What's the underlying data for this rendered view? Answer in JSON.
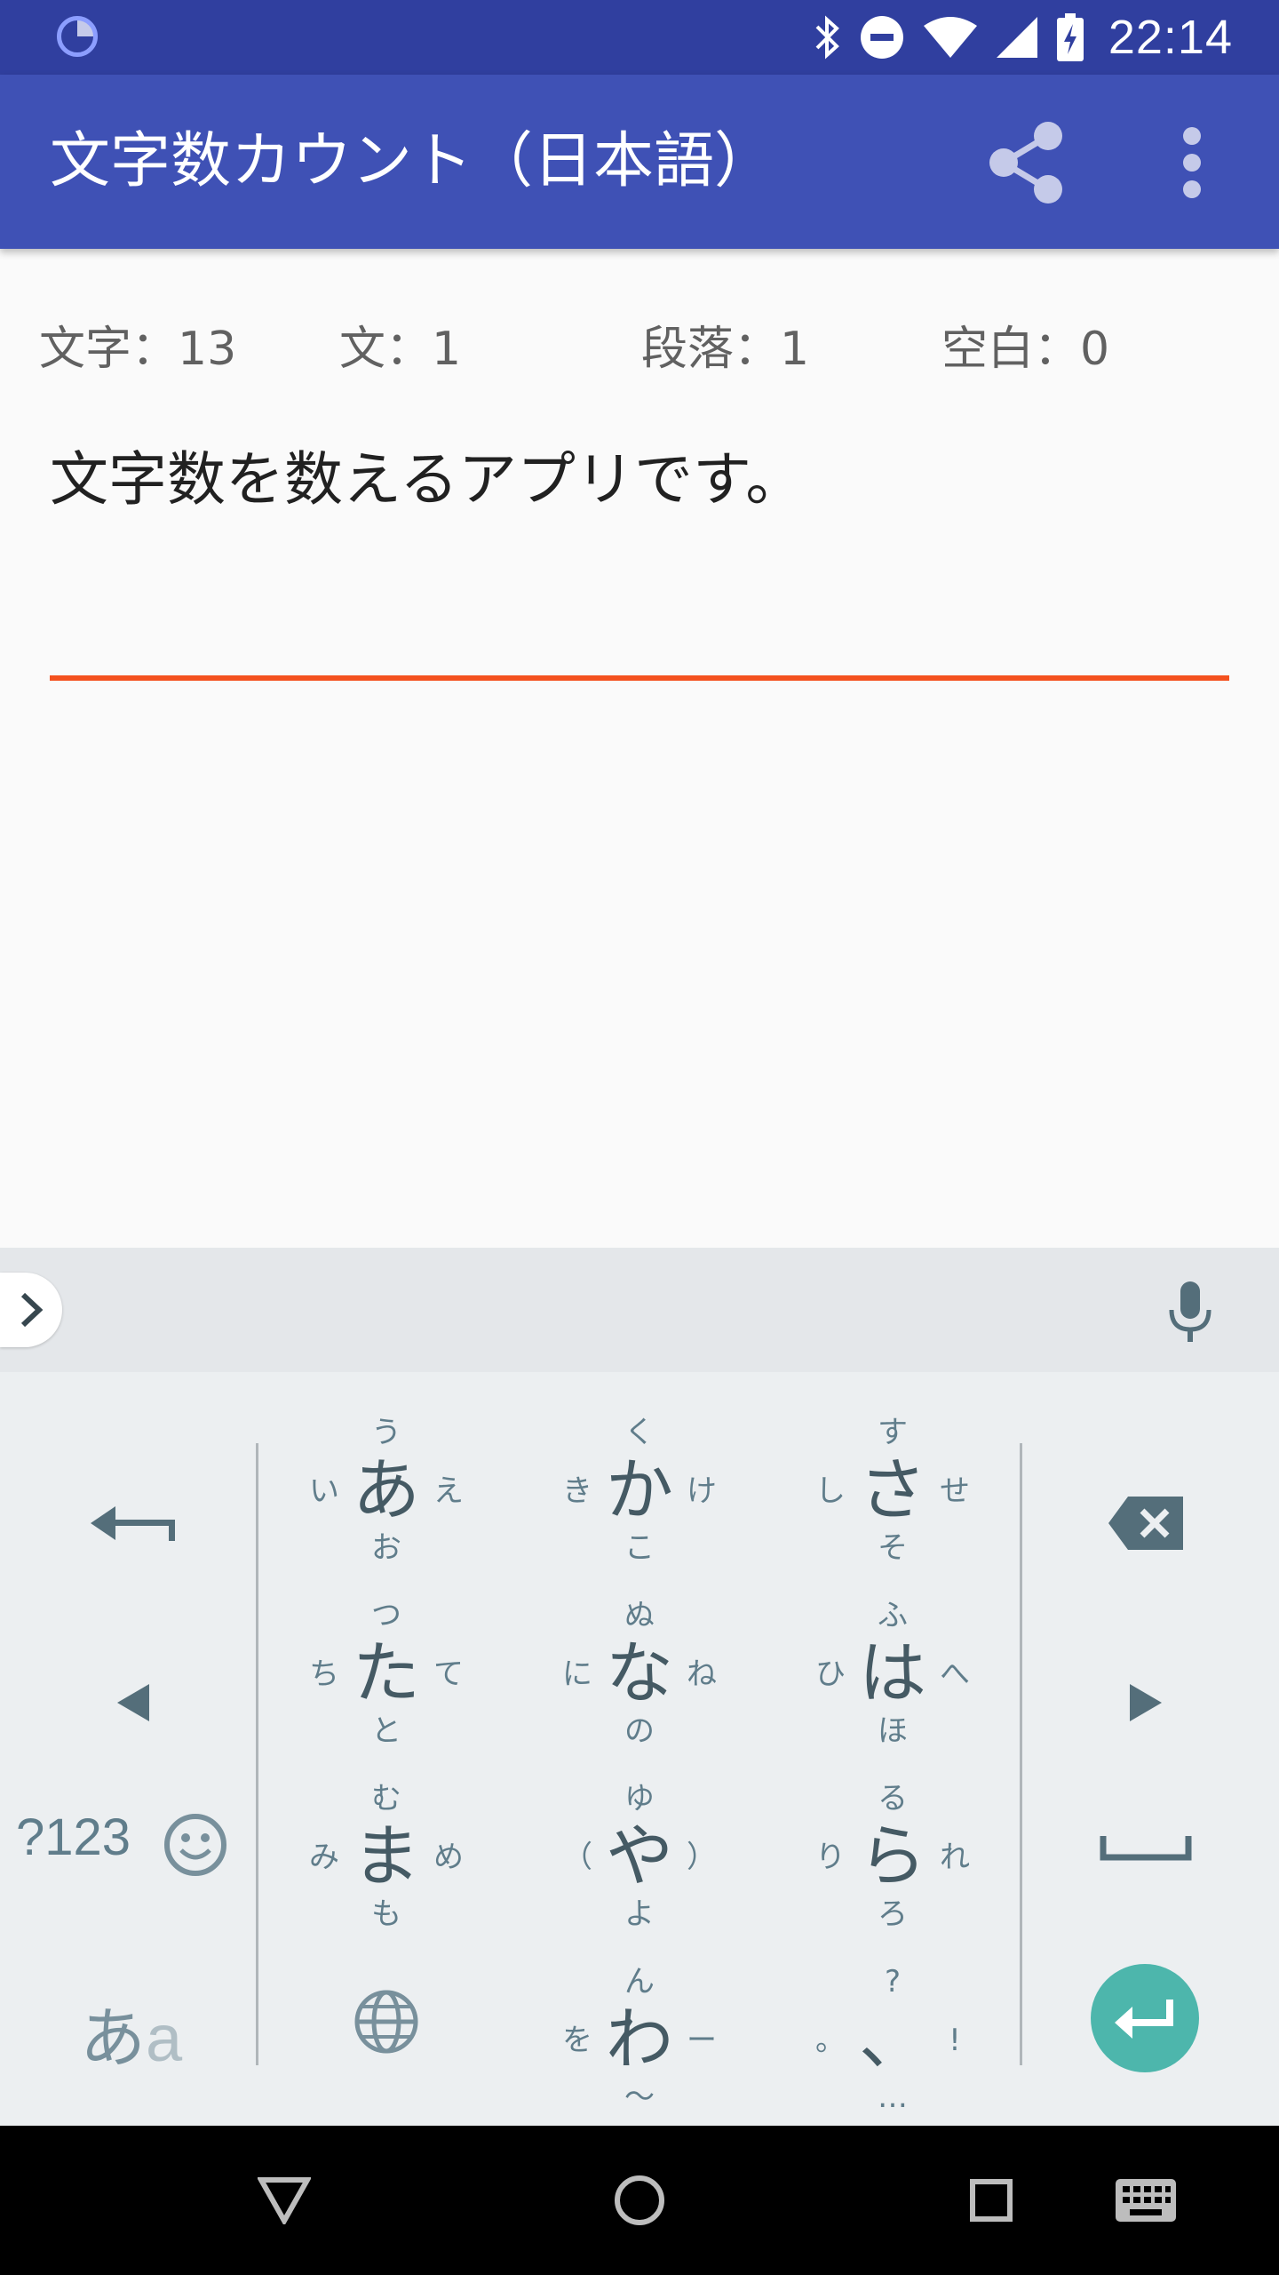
{
  "status_bar": {
    "time": "22:14",
    "icons": [
      "loading-spinner-icon",
      "bluetooth-icon",
      "do-not-disturb-icon",
      "wifi-icon",
      "signal-icon",
      "battery-charging-icon"
    ]
  },
  "app_bar": {
    "title": "文字数カウント（日本語）",
    "actions": [
      "share-icon",
      "more-vert-icon"
    ]
  },
  "stats": {
    "characters": "文字：13",
    "sentences": "文：1",
    "paragraphs": "段落：1",
    "spaces": "空白：0"
  },
  "editor": {
    "value": "文字数を数えるアプリです。",
    "accent_color": "#f4511e"
  },
  "keyboard": {
    "flick_keys": [
      {
        "main": "あ",
        "top": "う",
        "left": "い",
        "right": "え",
        "bottom": "お"
      },
      {
        "main": "か",
        "top": "く",
        "left": "き",
        "right": "け",
        "bottom": "こ"
      },
      {
        "main": "さ",
        "top": "す",
        "left": "し",
        "right": "せ",
        "bottom": "そ"
      },
      {
        "main": "た",
        "top": "つ",
        "left": "ち",
        "right": "て",
        "bottom": "と"
      },
      {
        "main": "な",
        "top": "ぬ",
        "left": "に",
        "right": "ね",
        "bottom": "の"
      },
      {
        "main": "は",
        "top": "ふ",
        "left": "ひ",
        "right": "へ",
        "bottom": "ほ"
      },
      {
        "main": "ま",
        "top": "む",
        "left": "み",
        "right": "め",
        "bottom": "も"
      },
      {
        "main": "や",
        "top": "ゆ",
        "left": "（",
        "right": "）",
        "bottom": "よ"
      },
      {
        "main": "ら",
        "top": "る",
        "left": "り",
        "right": "れ",
        "bottom": "ろ"
      },
      {
        "main": "わ",
        "top": "ん",
        "left": "を",
        "right": "ー",
        "bottom": "〜"
      },
      {
        "main": "、",
        "top": "?",
        "left": "。",
        "right": "!",
        "bottom": "…"
      }
    ],
    "symbols_key": "?123",
    "kana_toggle": {
      "kana": "あ",
      "latin": "a"
    },
    "enter_color": "#4db6ac",
    "icons": [
      "chevron-right-icon",
      "mic-icon",
      "undo-arrow-icon",
      "backspace-icon",
      "cursor-left-icon",
      "cursor-right-icon",
      "emoji-icon",
      "globe-icon",
      "space-icon",
      "enter-icon"
    ]
  },
  "nav_bar": {
    "icons": [
      "back-icon",
      "home-icon",
      "recents-icon",
      "keyboard-switch-icon"
    ]
  },
  "colors": {
    "status_bar": "#303f9f",
    "app_bar": "#3f51b5",
    "keyboard_bg": "#eceff1"
  }
}
